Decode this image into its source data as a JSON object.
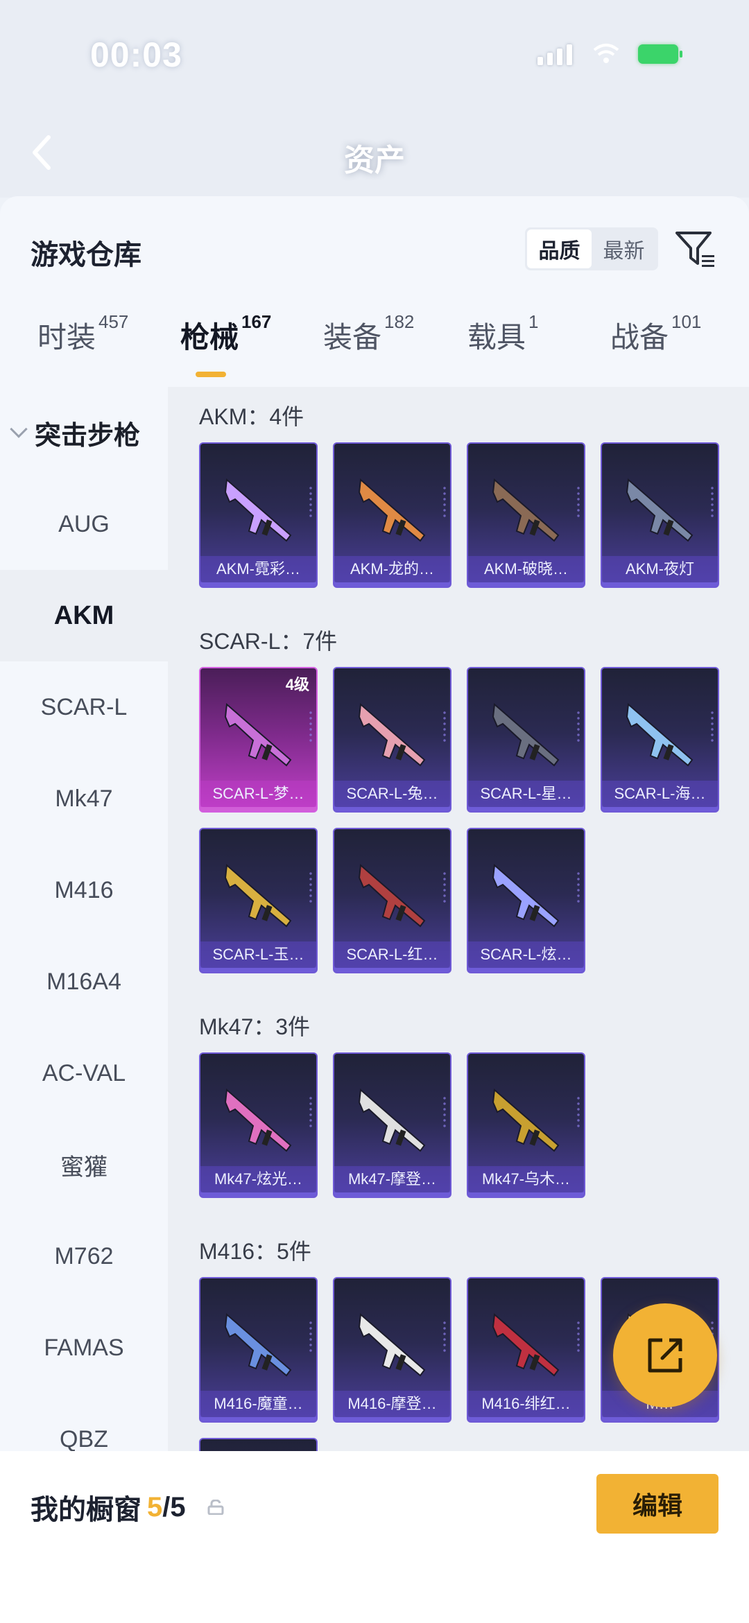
{
  "status_bar": {
    "time": "00:03"
  },
  "header": {
    "title": "资产"
  },
  "sheet": {
    "title": "游戏仓库",
    "sort_options": [
      "品质",
      "最新"
    ],
    "sort_selected": "品质"
  },
  "tabs": [
    {
      "label": "时装",
      "count": "457"
    },
    {
      "label": "枪械",
      "count": "167"
    },
    {
      "label": "装备",
      "count": "182"
    },
    {
      "label": "载具",
      "count": "1"
    },
    {
      "label": "战备",
      "count": "101"
    }
  ],
  "active_tab": "枪械",
  "sidebar": {
    "category": "突击步枪",
    "items": [
      "AUG",
      "AKM",
      "SCAR-L",
      "Mk47",
      "M416",
      "M16A4",
      "AC-VAL",
      "蜜獾",
      "M762",
      "FAMAS",
      "QBZ"
    ],
    "active_item": "AKM"
  },
  "groups": [
    {
      "title": "AKM：4件",
      "items": [
        {
          "name": "AKM-霓彩…"
        },
        {
          "name": "AKM-龙的…"
        },
        {
          "name": "AKM-破晓…"
        },
        {
          "name": "AKM-夜灯"
        }
      ]
    },
    {
      "title": "SCAR-L：7件",
      "items": [
        {
          "name": "SCAR-L-梦…",
          "level": "4级"
        },
        {
          "name": "SCAR-L-兔…"
        },
        {
          "name": "SCAR-L-星…"
        },
        {
          "name": "SCAR-L-海…"
        },
        {
          "name": "SCAR-L-玉…"
        },
        {
          "name": "SCAR-L-红…"
        },
        {
          "name": "SCAR-L-炫…"
        }
      ]
    },
    {
      "title": "Mk47：3件",
      "items": [
        {
          "name": "Mk47-炫光…"
        },
        {
          "name": "Mk47-摩登…"
        },
        {
          "name": "Mk47-乌木…"
        }
      ]
    },
    {
      "title": "M416：5件",
      "items": [
        {
          "name": "M416-魔童…"
        },
        {
          "name": "M416-摩登…"
        },
        {
          "name": "M416-绯红…"
        },
        {
          "name": "M…"
        }
      ]
    }
  ],
  "bottom_bar": {
    "title": "我的橱窗",
    "count_current": "5",
    "count_separator": "/",
    "count_total": "5",
    "edit_label": "编辑"
  },
  "colors": {
    "accent": "#f2b234",
    "card_epic": "#6f5ad6",
    "card_legend": "#d35ee0"
  }
}
